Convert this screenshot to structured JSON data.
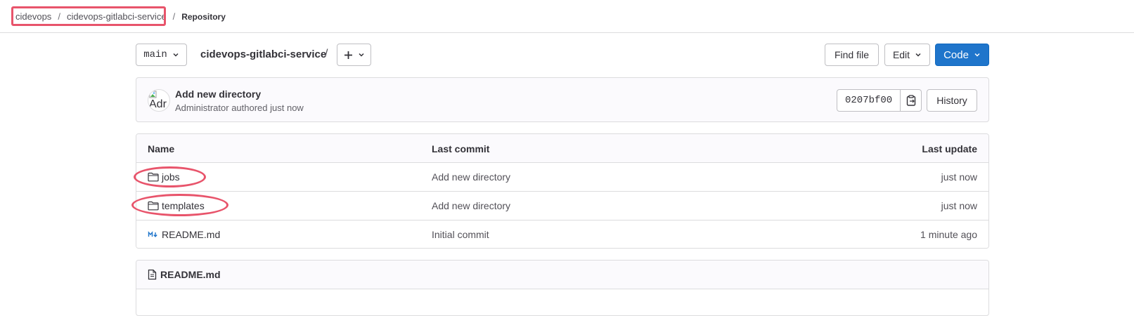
{
  "breadcrumb": {
    "items": [
      "cidevops",
      "cidevops-gitlabci-service"
    ],
    "separator": "/",
    "current": "Repository"
  },
  "toolbar": {
    "branch": "main",
    "repo_name": "cidevops-gitlabci-service",
    "path_separator": "/",
    "find_file_label": "Find file",
    "edit_label": "Edit",
    "code_label": "Code"
  },
  "commit": {
    "title": "Add new directory",
    "meta": "Administrator authored just now",
    "avatar_alt": "Adr",
    "sha": "0207bf00",
    "history_label": "History"
  },
  "table": {
    "headers": {
      "name": "Name",
      "last_commit": "Last commit",
      "last_update": "Last update"
    },
    "rows": [
      {
        "name": "jobs",
        "icon": "folder-icon",
        "last_commit": "Add new directory",
        "last_update": "just now"
      },
      {
        "name": "templates",
        "icon": "folder-icon",
        "last_commit": "Add new directory",
        "last_update": "just now"
      },
      {
        "name": "README.md",
        "icon": "markdown-icon",
        "last_commit": "Initial commit",
        "last_update": "1 minute ago"
      }
    ]
  },
  "readme": {
    "title": "README.md"
  },
  "colors": {
    "primary": "#1f75cb",
    "annotation": "#e8546b",
    "border": "#dcdcde"
  }
}
